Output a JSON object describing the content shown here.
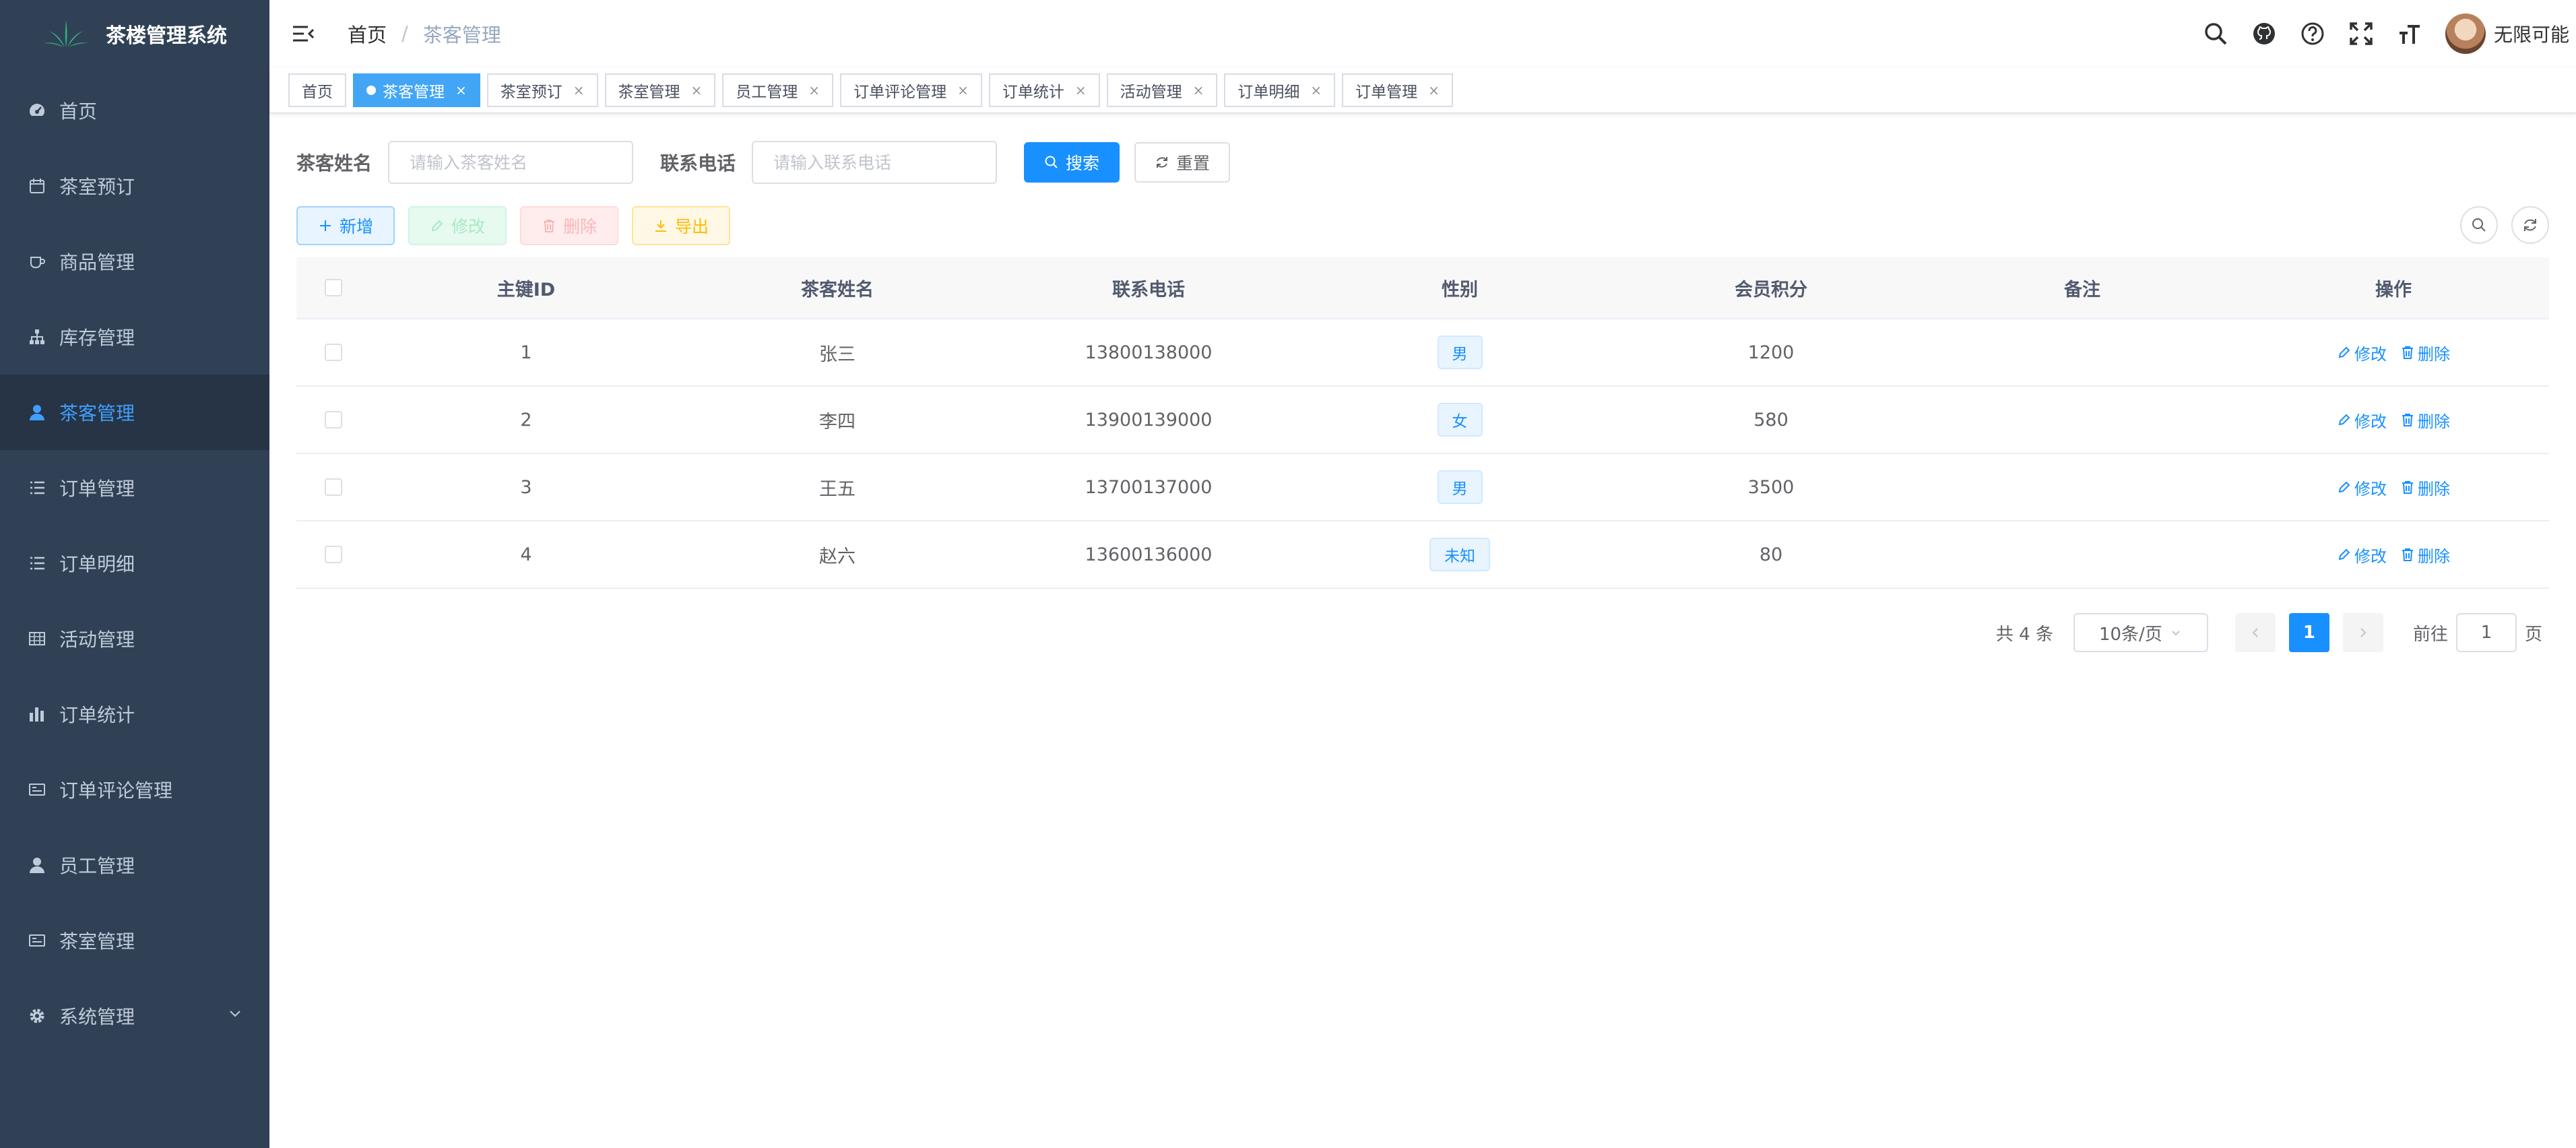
{
  "app": {
    "title": "茶楼管理系统"
  },
  "sidebar": {
    "items": [
      {
        "label": "首页",
        "icon": "dashboard-icon",
        "active": false
      },
      {
        "label": "茶室预订",
        "icon": "calendar-icon",
        "active": false
      },
      {
        "label": "商品管理",
        "icon": "cup-icon",
        "active": false
      },
      {
        "label": "库存管理",
        "icon": "tree-icon",
        "active": false
      },
      {
        "label": "茶客管理",
        "icon": "user-icon",
        "active": true
      },
      {
        "label": "订单管理",
        "icon": "list-icon",
        "active": false
      },
      {
        "label": "订单明细",
        "icon": "list-icon",
        "active": false
      },
      {
        "label": "活动管理",
        "icon": "grid-icon",
        "active": false
      },
      {
        "label": "订单统计",
        "icon": "chart-icon",
        "active": false
      },
      {
        "label": "订单评论管理",
        "icon": "card-icon",
        "active": false
      },
      {
        "label": "员工管理",
        "icon": "user-icon",
        "active": false
      },
      {
        "label": "茶室管理",
        "icon": "card-icon",
        "active": false
      },
      {
        "label": "系统管理",
        "icon": "gear-icon",
        "active": false
      }
    ]
  },
  "navbar": {
    "breadcrumb": {
      "home": "首页",
      "separator": "/",
      "current": "茶客管理"
    },
    "username": "无限可能"
  },
  "tags": [
    {
      "label": "首页",
      "active": false,
      "closable": false
    },
    {
      "label": "茶客管理",
      "active": true,
      "closable": true
    },
    {
      "label": "茶室预订",
      "active": false,
      "closable": true
    },
    {
      "label": "茶室管理",
      "active": false,
      "closable": true
    },
    {
      "label": "员工管理",
      "active": false,
      "closable": true
    },
    {
      "label": "订单评论管理",
      "active": false,
      "closable": true
    },
    {
      "label": "订单统计",
      "active": false,
      "closable": true
    },
    {
      "label": "活动管理",
      "active": false,
      "closable": true
    },
    {
      "label": "订单明细",
      "active": false,
      "closable": true
    },
    {
      "label": "订单管理",
      "active": false,
      "closable": true
    }
  ],
  "tag_close_glyph": "×",
  "search": {
    "name_label": "茶客姓名",
    "name_placeholder": "请输入茶客姓名",
    "phone_label": "联系电话",
    "phone_placeholder": "请输入联系电话",
    "search_button": "搜索",
    "reset_button": "重置"
  },
  "toolbar": {
    "add": "新增",
    "edit": "修改",
    "delete": "删除",
    "export": "导出"
  },
  "table": {
    "columns": [
      "主键ID",
      "茶客姓名",
      "联系电话",
      "性别",
      "会员积分",
      "备注",
      "操作"
    ],
    "rows": [
      {
        "id": "1",
        "name": "张三",
        "phone": "13800138000",
        "gender": "男",
        "points": "1200",
        "remark": ""
      },
      {
        "id": "2",
        "name": "李四",
        "phone": "13900139000",
        "gender": "女",
        "points": "580",
        "remark": ""
      },
      {
        "id": "3",
        "name": "王五",
        "phone": "13700137000",
        "gender": "男",
        "points": "3500",
        "remark": ""
      },
      {
        "id": "4",
        "name": "赵六",
        "phone": "13600136000",
        "gender": "未知",
        "points": "80",
        "remark": ""
      }
    ],
    "edit_label": "修改",
    "delete_label": "删除"
  },
  "pagination": {
    "total_text": "共 4 条",
    "page_size": "10条/页",
    "current_page": "1",
    "goto_prefix": "前往",
    "goto_value": "1",
    "goto_suffix": "页"
  },
  "colors": {
    "sidebar_bg": "#304156",
    "sidebar_active_bg": "#263445",
    "accent": "#1890ff",
    "active_tag": "#42a5f5"
  }
}
